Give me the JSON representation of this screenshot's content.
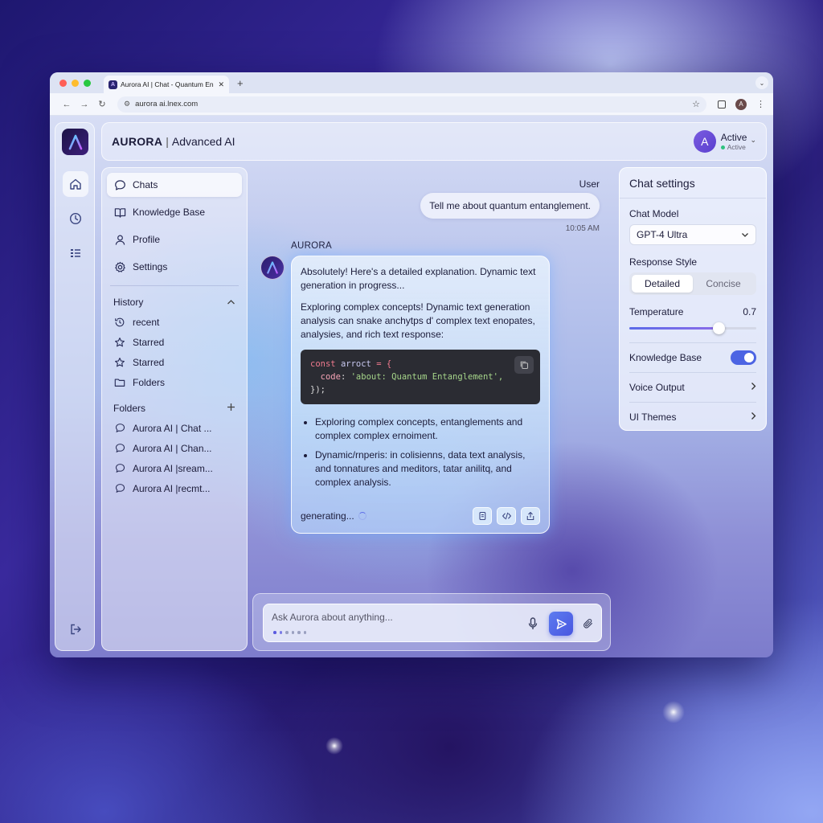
{
  "browser": {
    "tab_title": "Aurora AI | Chat - Quantum En",
    "url": "aurora ai.lnex.com"
  },
  "header": {
    "brand": "AURORA",
    "separator": "|",
    "subtitle": "Advanced AI",
    "user_initial": "A",
    "user_name": "Active",
    "user_status": "Active"
  },
  "sidebar": {
    "nav": [
      {
        "label": "Chats",
        "icon": "chat-bubble-icon"
      },
      {
        "label": "Knowledge Base",
        "icon": "book-icon"
      },
      {
        "label": "Profile",
        "icon": "user-icon"
      },
      {
        "label": "Settings",
        "icon": "gear-icon"
      }
    ],
    "history": {
      "title": "History",
      "items": [
        {
          "label": "recent",
          "icon": "history-icon"
        },
        {
          "label": "Starred",
          "icon": "star-icon"
        },
        {
          "label": "Starred",
          "icon": "star-icon"
        },
        {
          "label": "Folders",
          "icon": "folder-icon"
        }
      ]
    },
    "folders": {
      "title": "Folders",
      "items": [
        {
          "label": "Aurora AI | Chat ..."
        },
        {
          "label": "Aurora AI | Chan..."
        },
        {
          "label": "Aurora AI |sream..."
        },
        {
          "label": "Aurora AI |recmt..."
        }
      ]
    }
  },
  "chat": {
    "user_label": "User",
    "user_message": "Tell me about quantum entanglement.",
    "user_time": "10:05 AM",
    "ai_label": "AURORA",
    "ai_para1": "Absolutely! Here's a detailed explanation. Dynamic text generation in progress...",
    "ai_para2": "Exploring complex concepts! Dynamic text generation analysis can snake anchytps d' complex text enopates, analysies, and rich text response:",
    "code": {
      "line1_kw": "const",
      "line1_var": "arroct",
      "line1_rest": " = {",
      "line2_prop": "code",
      "line2_str": "'about: Quantum Entanglement',",
      "line3": "});"
    },
    "bullets": [
      "Exploring complex concepts, entanglements and complex complex ernoiment.",
      "Dynamic/rnperis: in colisienns, data text analysis, and tonnatures and meditors, tatar anilitq, and complex analysis."
    ],
    "status": "generating..."
  },
  "composer": {
    "placeholder": "Ask Aurora about anything..."
  },
  "settings": {
    "title": "Chat settings",
    "model_label": "Chat Model",
    "model_value": "GPT-4 Ultra",
    "style_label": "Response Style",
    "style_options": [
      "Detailed",
      "Concise"
    ],
    "style_selected": "Detailed",
    "temperature_label": "Temperature",
    "temperature_value": "0.7",
    "temperature_fill_fraction": 0.7,
    "knowledge_base_label": "Knowledge Base",
    "knowledge_base_enabled": true,
    "voice_output_label": "Voice Output",
    "ui_themes_label": "UI Themes"
  },
  "colors": {
    "accent": "#4c64e3",
    "brand_dark": "#1b1346",
    "status_active": "#2ec27e"
  }
}
